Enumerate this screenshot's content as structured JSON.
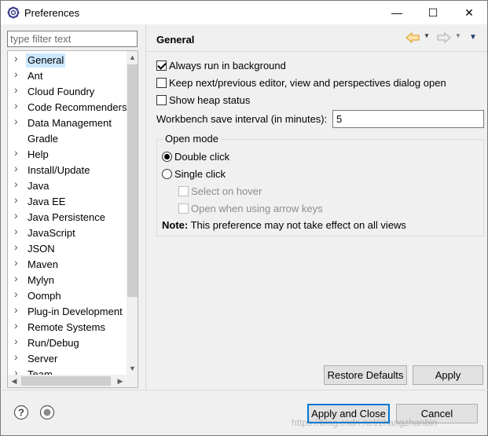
{
  "window": {
    "title": "Preferences",
    "minimize": "—",
    "maximize": "☐",
    "close": "✕"
  },
  "filter": {
    "placeholder": "type filter text",
    "value": ""
  },
  "tree": {
    "items": [
      {
        "label": "General",
        "selected": true,
        "expandable": true
      },
      {
        "label": "Ant",
        "expandable": true
      },
      {
        "label": "Cloud Foundry",
        "expandable": true
      },
      {
        "label": "Code Recommenders",
        "expandable": true
      },
      {
        "label": "Data Management",
        "expandable": true
      },
      {
        "label": "Gradle",
        "expandable": false
      },
      {
        "label": "Help",
        "expandable": true
      },
      {
        "label": "Install/Update",
        "expandable": true
      },
      {
        "label": "Java",
        "expandable": true
      },
      {
        "label": "Java EE",
        "expandable": true
      },
      {
        "label": "Java Persistence",
        "expandable": true
      },
      {
        "label": "JavaScript",
        "expandable": true
      },
      {
        "label": "JSON",
        "expandable": true
      },
      {
        "label": "Maven",
        "expandable": true
      },
      {
        "label": "Mylyn",
        "expandable": true
      },
      {
        "label": "Oomph",
        "expandable": true
      },
      {
        "label": "Plug-in Development",
        "expandable": true
      },
      {
        "label": "Remote Systems",
        "expandable": true
      },
      {
        "label": "Run/Debug",
        "expandable": true
      },
      {
        "label": "Server",
        "expandable": true
      },
      {
        "label": "Team",
        "expandable": true
      }
    ]
  },
  "page": {
    "title": "General",
    "options": {
      "always_run_background": {
        "label": "Always run in background",
        "checked": true
      },
      "keep_next_previous": {
        "label": "Keep next/previous editor, view and perspectives dialog open",
        "checked": false
      },
      "show_heap_status": {
        "label": "Show heap status",
        "checked": false
      }
    },
    "interval": {
      "label": "Workbench save interval (in minutes):",
      "value": "5"
    },
    "open_mode": {
      "title": "Open mode",
      "double_click": {
        "label": "Double click",
        "selected": true
      },
      "single_click": {
        "label": "Single click",
        "selected": false
      },
      "select_on_hover": {
        "label": "Select on hover",
        "checked": false,
        "enabled": false
      },
      "open_arrow_keys": {
        "label": "Open when using arrow keys",
        "checked": false,
        "enabled": false
      },
      "note_bold": "Note:",
      "note_text": " This preference may not take effect on all views"
    },
    "restore_defaults": "Restore Defaults",
    "apply": "Apply"
  },
  "footer": {
    "apply_and_close": "Apply and Close",
    "cancel": "Cancel",
    "watermark": "https://blog.csdn.net/zhangzhanbin"
  },
  "colors": {
    "selection": "#cce8ff",
    "default_button_border": "#0078d7",
    "nav_arrow": "#f0a830"
  }
}
